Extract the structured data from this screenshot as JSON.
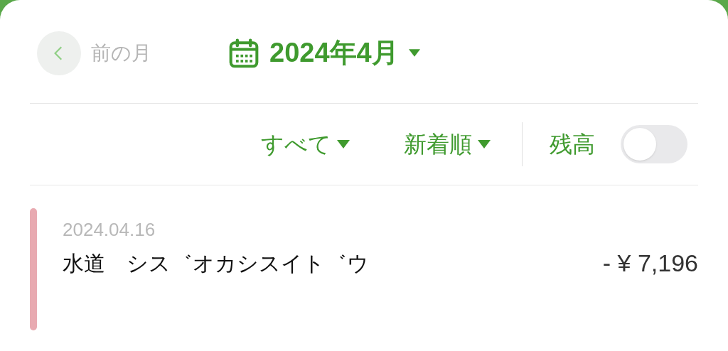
{
  "header": {
    "prev_label": "前の月",
    "month_label": "2024年4月"
  },
  "filters": [
    {
      "label": "すべて"
    },
    {
      "label": "新着順"
    }
  ],
  "balance": {
    "label": "残高",
    "on": false
  },
  "transactions": [
    {
      "date": "2024.04.16",
      "name": "水道　シス゛オカシスイト゛ウ",
      "amount": "- ¥ 7,196",
      "color": "#e8aab1"
    }
  ]
}
